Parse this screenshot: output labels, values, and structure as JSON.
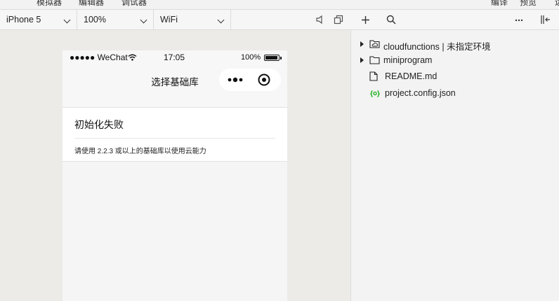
{
  "top_menu": {
    "simulator": "模拟器",
    "editor": "编辑器",
    "debugger": "调试器",
    "compile": "编译",
    "preview": "预览",
    "more": "远"
  },
  "sim_toolbar": {
    "device": "iPhone 5",
    "zoom": "100%",
    "network": "WiFi"
  },
  "phone": {
    "carrier": "●●●●● WeChat",
    "time": "17:05",
    "battery_text": "100%",
    "battery_level": 1.0,
    "nav_title": "选择基础库",
    "error_title": "初始化失败",
    "error_desc": "请使用 2.2.3 或以上的基础库以使用云能力"
  },
  "file_tree": {
    "items": [
      {
        "label": "cloudfunctions | 未指定环境",
        "icon": "cloud-folder-icon"
      },
      {
        "label": "miniprogram",
        "icon": "folder-icon"
      },
      {
        "label": "README.md",
        "icon": "file-icon"
      },
      {
        "label": "project.config.json",
        "icon": "json-icon"
      }
    ]
  },
  "colors": {
    "json_icon": "#1aad19",
    "background": "#ecebe8",
    "panel": "#f3f3f3"
  }
}
